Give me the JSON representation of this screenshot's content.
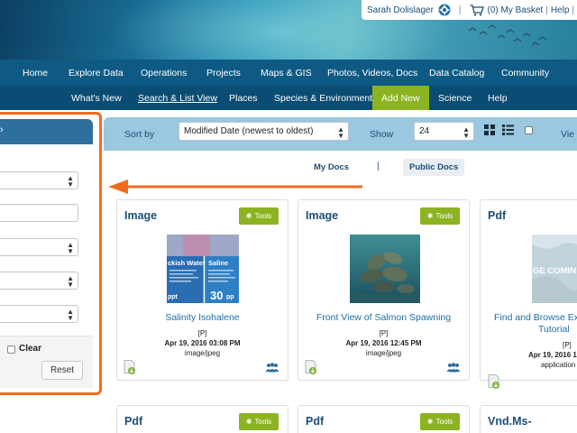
{
  "header": {
    "user_name": "Sarah Dolislager",
    "basket": "(0) My Basket",
    "help": "Help"
  },
  "nav_main": [
    "Home",
    "Explore Data",
    "Operations",
    "Projects",
    "Maps & GIS",
    "Photos, Videos, Docs",
    "Data Catalog",
    "Community"
  ],
  "nav_sub": {
    "whats_new": "What's New",
    "search_list": "Search & List View",
    "places": "Places",
    "species_env": "Species & Environment",
    "add_new": "Add New",
    "science": "Science",
    "help": "Help"
  },
  "left_panel": {
    "clear_label": "Clear",
    "reset_label": "Reset"
  },
  "sortbar": {
    "sort_label": "Sort by",
    "sort_value": "Modified Date (newest to oldest)",
    "show_label": "Show",
    "show_value": "24",
    "view_label": "Vie"
  },
  "doc_tabs": {
    "my_docs": "My Docs",
    "separator": "|",
    "public_docs": "Public Docs"
  },
  "tools_label": "Tools",
  "cards": [
    {
      "type": "Image",
      "title": "Salinity Isohalene",
      "flag": "[P]",
      "date": "Apr 19, 2016 03:08 PM",
      "mime": "image/jpeg"
    },
    {
      "type": "Image",
      "title": "Front View of Salmon Spawning",
      "flag": "[P]",
      "date": "Apr 19, 2016 12:45 PM",
      "mime": "image/jpeg"
    },
    {
      "type": "Pdf",
      "title_line1": "Find and Browse Ex",
      "title_line2": "Tutorial",
      "flag": "[P]",
      "date": "Apr 19, 2016 1",
      "mime": "application",
      "thumb_text": "GE COMIN"
    },
    {
      "type": "Pdf"
    },
    {
      "type": "Pdf"
    },
    {
      "type": "Vnd.Ms-"
    }
  ],
  "thumb1": {
    "brackish": "ckish Water",
    "saline": "Saline",
    "num": "30",
    "unit_left": "ppt",
    "unit_right": "pp"
  },
  "colors": {
    "nav_primary": "#0e5a85",
    "nav_secondary": "#0a4c73",
    "accent_green": "#8cb321",
    "highlight_orange": "#f26b1d",
    "link_blue": "#1d6fa6"
  }
}
